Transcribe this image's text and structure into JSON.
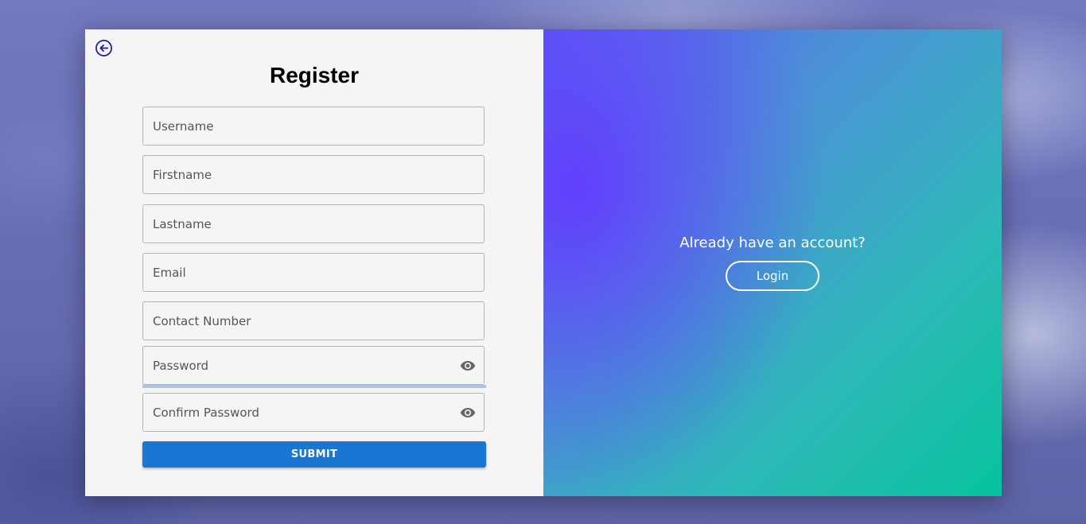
{
  "register": {
    "title": "Register",
    "fields": {
      "username": {
        "placeholder": "Username"
      },
      "firstname": {
        "placeholder": "Firstname"
      },
      "lastname": {
        "placeholder": "Lastname"
      },
      "email": {
        "placeholder": "Email"
      },
      "contact": {
        "placeholder": "Contact Number"
      },
      "password": {
        "placeholder": "Password"
      },
      "confirm_password": {
        "placeholder": "Confirm Password"
      }
    },
    "submit_label": "SUBMIT"
  },
  "aside": {
    "prompt": "Already have an account?",
    "login_label": "Login"
  },
  "colors": {
    "submit": "#1976d2",
    "back_icon": "#1a1aa6",
    "gradient_start": "#633cff",
    "gradient_end": "#06c39c"
  },
  "icons": {
    "back": "arrow-left-circle-icon",
    "password_toggle": "eye-icon"
  }
}
